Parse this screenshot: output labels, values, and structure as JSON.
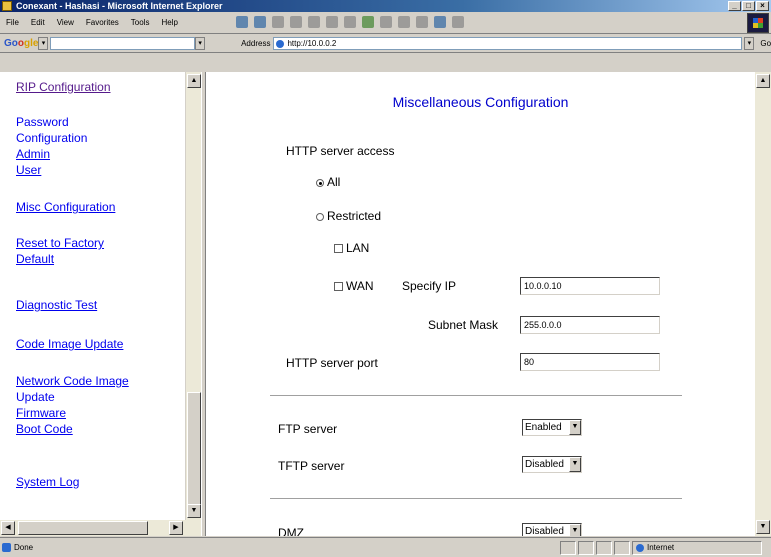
{
  "window": {
    "title": "Conexant - Hashasi - Microsoft Internet Explorer",
    "buttons": [
      "_",
      "□",
      "×"
    ]
  },
  "menubar": {
    "items": [
      "File",
      "Edit",
      "View",
      "Favorites",
      "Tools",
      "Help"
    ]
  },
  "toolbar": {
    "google_logo": [
      "Go",
      "o",
      "gle"
    ],
    "google_drop": "▾",
    "address_label": "Address",
    "address_value": "http://10.0.0.2",
    "go_label": "Go"
  },
  "sidebar": {
    "items": [
      {
        "label": "RIP Configuration",
        "visited": true
      },
      {
        "label": "Password",
        "link": false
      },
      {
        "label": "Configuration",
        "link": false
      },
      {
        "label": "Admin"
      },
      {
        "label": "User"
      },
      {
        "label": "Misc Configuration"
      },
      {
        "label": "Reset to Factory"
      },
      {
        "label": "Default"
      },
      {
        "label": "Diagnostic Test"
      },
      {
        "label": "Code Image Update"
      },
      {
        "label": "Network Code Image"
      },
      {
        "label": "Update",
        "link": false
      },
      {
        "label": "Firmware"
      },
      {
        "label": "Boot Code"
      },
      {
        "label": "System Log"
      }
    ]
  },
  "main": {
    "title": "Miscellaneous Configuration",
    "http_access": {
      "label": "HTTP server access",
      "all_label": "All",
      "all_selected": true,
      "restricted_label": "Restricted",
      "lan_label": "LAN",
      "wan_label": "WAN",
      "specify_ip_label": "Specify IP",
      "specify_ip_value": "10.0.0.10",
      "subnet_label": "Subnet Mask",
      "subnet_value": "255.0.0.0"
    },
    "http_port": {
      "label": "HTTP server port",
      "value": "80"
    },
    "ftp_server": {
      "label": "FTP server",
      "value": "Enabled"
    },
    "tftp_server": {
      "label": "TFTP server",
      "value": "Disabled"
    },
    "dmz": {
      "label": "DMZ",
      "value": "Disabled"
    }
  },
  "statusbar": {
    "left": "Done",
    "zone": "Internet"
  }
}
